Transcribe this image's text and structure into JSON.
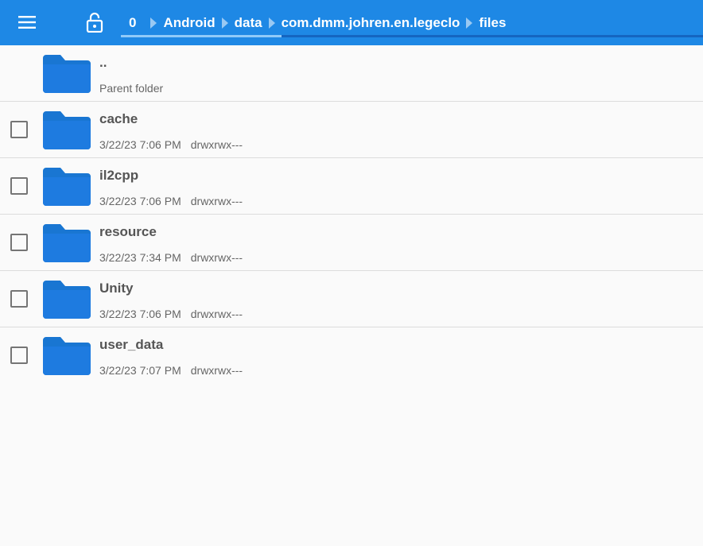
{
  "toolbar": {
    "menu_icon": "hamburger-menu-icon",
    "lock_icon": "unlocked-padlock-icon",
    "accent": "#1e88e5",
    "breadcrumb": [
      "0",
      "Android",
      "data",
      "com.dmm.johren.en.legeclo",
      "files"
    ]
  },
  "parent": {
    "name": "..",
    "subtitle": "Parent folder"
  },
  "folder_color": "#1976d2",
  "items": [
    {
      "name": "cache",
      "date": "3/22/23 7:06 PM",
      "perm": "drwxrwx---"
    },
    {
      "name": "il2cpp",
      "date": "3/22/23 7:06 PM",
      "perm": "drwxrwx---"
    },
    {
      "name": "resource",
      "date": "3/22/23 7:34 PM",
      "perm": "drwxrwx---"
    },
    {
      "name": "Unity",
      "date": "3/22/23 7:06 PM",
      "perm": "drwxrwx---"
    },
    {
      "name": "user_data",
      "date": "3/22/23 7:07 PM",
      "perm": "drwxrwx---"
    }
  ]
}
